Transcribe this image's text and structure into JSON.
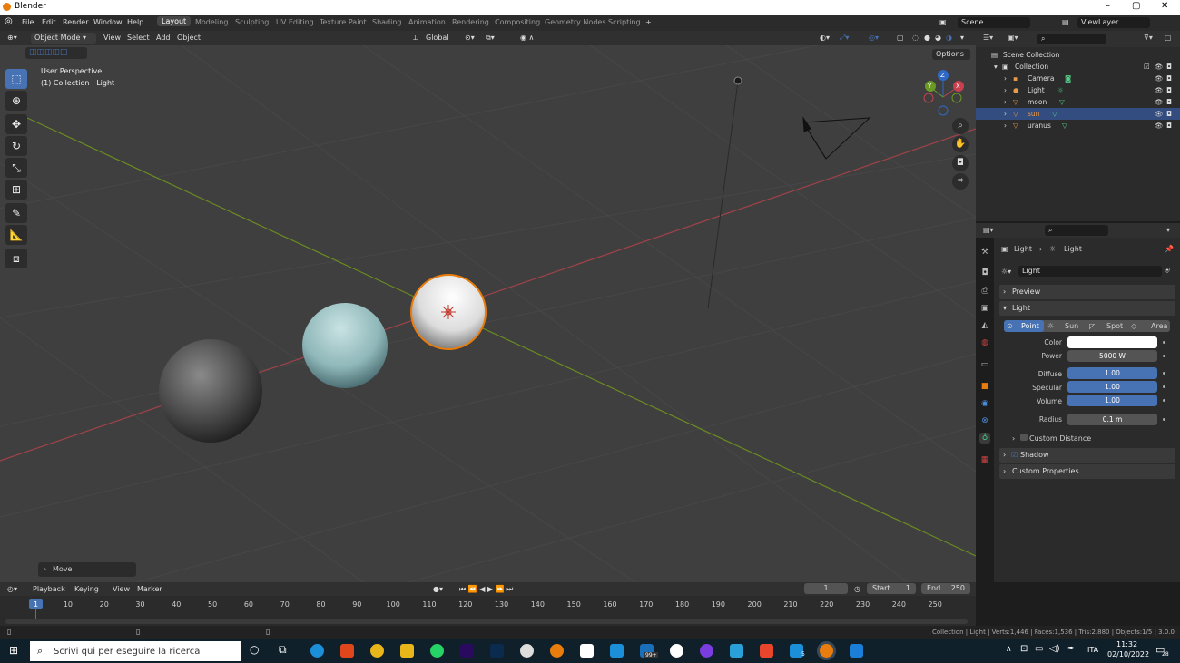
{
  "window": {
    "title": "Blender",
    "min": "–",
    "max": "▢",
    "close": "✕"
  },
  "menu": [
    "File",
    "Edit",
    "Render",
    "Window",
    "Help"
  ],
  "workspaces": [
    "Layout",
    "Modeling",
    "Sculpting",
    "UV Editing",
    "Texture Paint",
    "Shading",
    "Animation",
    "Rendering",
    "Compositing",
    "Geometry Nodes",
    "Scripting",
    "+"
  ],
  "topright": {
    "scene": "Scene",
    "viewlayer": "ViewLayer"
  },
  "viewport_header": {
    "mode": "Object Mode",
    "view": "View",
    "select": "Select",
    "add": "Add",
    "object": "Object",
    "orientation": "Global",
    "options": "Options"
  },
  "viewport_overlay": {
    "perspective": "User Perspective",
    "context": "(1) Collection | Light"
  },
  "gizmo": {
    "x": "X",
    "y": "Y",
    "z": "Z"
  },
  "operator_panel": "Move",
  "outliner": {
    "root": "Scene Collection",
    "collection": "Collection",
    "items": [
      {
        "name": "Camera",
        "selected": false
      },
      {
        "name": "Light",
        "selected": false
      },
      {
        "name": "moon",
        "selected": false
      },
      {
        "name": "sun",
        "selected": true
      },
      {
        "name": "uranus",
        "selected": false
      }
    ]
  },
  "properties": {
    "breadcrumb1": "Light",
    "breadcrumb2": "Light",
    "datablock": "Light",
    "preview": "Preview",
    "light_panel": "Light",
    "types": [
      "Point",
      "Sun",
      "Spot",
      "Area"
    ],
    "color_label": "Color",
    "power_label": "Power",
    "power": "5000 W",
    "diffuse_label": "Diffuse",
    "diffuse": "1.00",
    "specular_label": "Specular",
    "specular": "1.00",
    "volume_label": "Volume",
    "volume": "1.00",
    "radius_label": "Radius",
    "radius": "0.1 m",
    "custom_distance": "Custom Distance",
    "shadow": "Shadow",
    "custom_props": "Custom Properties",
    "light_color": "#ffffff"
  },
  "timeline": {
    "playback": "Playback",
    "keying": "Keying",
    "view": "View",
    "marker": "Marker",
    "current": "1",
    "start_label": "Start",
    "start": "1",
    "end_label": "End",
    "end": "250",
    "ticks": [
      "1",
      "10",
      "20",
      "30",
      "40",
      "50",
      "60",
      "70",
      "80",
      "90",
      "100",
      "110",
      "120",
      "130",
      "140",
      "150",
      "160",
      "170",
      "180",
      "190",
      "200",
      "210",
      "220",
      "230",
      "240",
      "250"
    ]
  },
  "status": "Collection | Light | Verts:1,446 | Faces:1,536 | Tris:2,880 | Objects:1/5 | 3.0.0",
  "taskbar": {
    "search": "Scrivi qui per eseguire la ricerca",
    "lang": "ITA",
    "time": "11:32",
    "date": "02/10/2022",
    "badge": "99+",
    "badge2": "5",
    "notif": "28"
  },
  "colors": {
    "accent": "#4772b3",
    "selection": "#e87d0d",
    "grid": "#3f3f3f"
  }
}
